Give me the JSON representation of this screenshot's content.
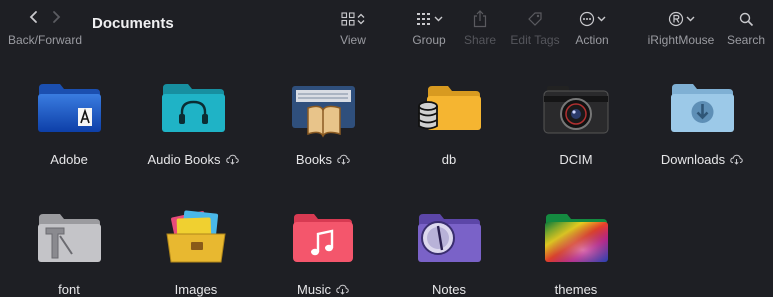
{
  "window": {
    "title": "Documents"
  },
  "toolbar": {
    "back_forward_label": "Back/Forward",
    "view_label": "View",
    "group_label": "Group",
    "share_label": "Share",
    "edit_tags_label": "Edit Tags",
    "action_label": "Action",
    "irightmouse_label": "iRightMouse",
    "search_label": "Search"
  },
  "files": [
    {
      "name": "Adobe",
      "cloud": false,
      "icon": "adobe-folder-icon"
    },
    {
      "name": "Audio Books",
      "cloud": true,
      "icon": "audiobooks-folder-icon",
      "badge": "Audio Books"
    },
    {
      "name": "Books",
      "cloud": true,
      "icon": "books-folder-icon"
    },
    {
      "name": "db",
      "cloud": false,
      "icon": "database-folder-icon"
    },
    {
      "name": "DCIM",
      "cloud": false,
      "icon": "camera-folder-icon"
    },
    {
      "name": "Downloads",
      "cloud": true,
      "icon": "downloads-folder-icon"
    },
    {
      "name": "font",
      "cloud": false,
      "icon": "font-folder-icon"
    },
    {
      "name": "Images",
      "cloud": false,
      "icon": "images-folder-icon"
    },
    {
      "name": "Music",
      "cloud": true,
      "icon": "music-folder-icon"
    },
    {
      "name": "Notes",
      "cloud": false,
      "icon": "notes-folder-icon"
    },
    {
      "name": "themes",
      "cloud": false,
      "icon": "themes-folder-icon"
    }
  ]
}
